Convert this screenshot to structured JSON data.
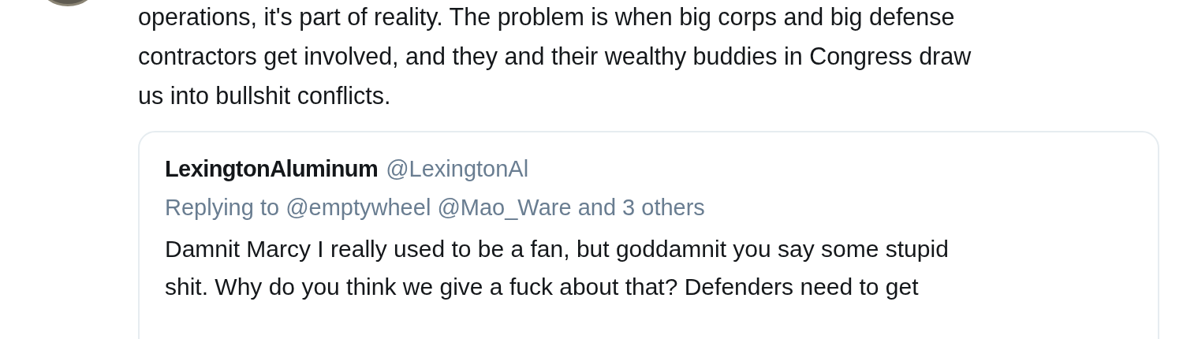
{
  "tweet": {
    "text_lines": [
      "operations, it's part of reality. The problem is when big corps and big defense",
      "contractors get involved, and they and their wealthy buddies in Congress draw",
      "us into bullshit conflicts."
    ]
  },
  "quoted_tweet": {
    "display_name": "LexingtonAluminum",
    "handle": "@LexingtonAl",
    "replying_to": "Replying to @emptywheel @Mao_Ware and 3 others",
    "text_lines": [
      "Damnit Marcy I really used to be a fan, but goddamnit you say some stupid",
      "shit. Why do you think we give a fuck about that? Defenders need to get"
    ]
  }
}
